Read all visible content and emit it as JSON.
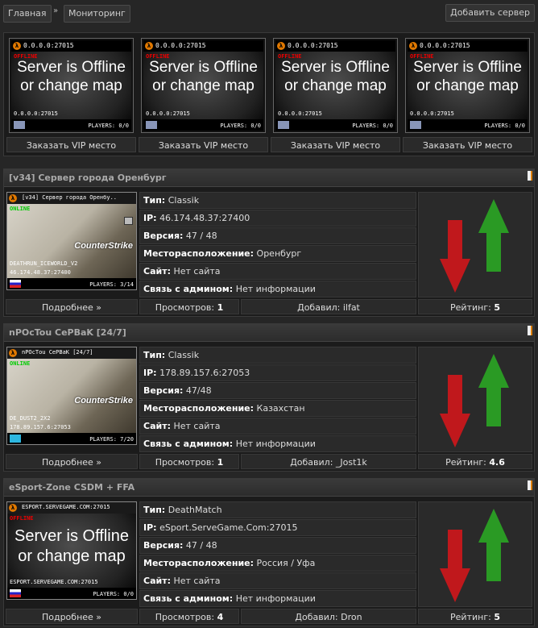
{
  "header": {
    "home": "Главная",
    "sep": "»",
    "monitoring": "Мониторинг",
    "add_server": "Добавить сервер"
  },
  "vip": {
    "ip": "0.0.0.0:27015",
    "status": "OFFLINE",
    "message_line1": "Server is Offline",
    "message_line2": "or change map",
    "players": "PLAYERS: 0/0",
    "order_label": "Заказать VIP место"
  },
  "labels": {
    "type": "Тип:",
    "ip": "IP:",
    "version": "Версия:",
    "location": "Месторасположение:",
    "site": "Сайт:",
    "contact": "Связь с админом:",
    "more": "Подробнее »",
    "views": "Просмотров:",
    "added": "Добавил:",
    "rating": "Рейтинг:"
  },
  "servers": [
    {
      "title": "[v34] Сервер города Оренбург",
      "banner_name": "[v34] Сервер города Оренбу..",
      "banner_status": "ONLINE",
      "banner_map": "DEATHRUN_ICEWORLD_V2",
      "banner_ip": "46.174.48.37:27400",
      "banner_players": "PLAYERS: 3/14",
      "type": "Classik",
      "ip": "46.174.48.37:27400",
      "version": "47 / 48",
      "location": "Оренбург",
      "site": "Нет сайта",
      "contact": "Нет информации",
      "views": "1",
      "added_by": "ilfat",
      "rating": "5"
    },
    {
      "title": "nPOcTou CePBaK [24/7]",
      "banner_name": "nPOcTou CePBaK [24/7]",
      "banner_status": "ONLINE",
      "banner_map": "DE_DUST2_2X2",
      "banner_ip": "178.89.157.6:27053",
      "banner_players": "PLAYERS: 7/20",
      "type": "Classik",
      "ip": "178.89.157.6:27053",
      "version": "47/48",
      "location": "Казахстан",
      "site": "Нет сайта",
      "contact": "Нет информации",
      "views": "1",
      "added_by": "_Jost1k",
      "rating": "4.6"
    },
    {
      "title": "eSport-Zone CSDM + FFA",
      "banner_name": "ESPORT.SERVEGAME.COM:27015",
      "banner_status": "OFFLINE",
      "banner_line1": "Server is Offline",
      "banner_line2": "or change map",
      "banner_ip": "ESPORT.SERVEGAME.COM:27015",
      "banner_players": "PLAYERS: 0/0",
      "type": "DeathMatch",
      "ip": "eSport.ServeGame.Com:27015",
      "version": "47 / 48",
      "location": "Россия / Уфа",
      "site": "Нет сайта",
      "contact": "Нет информации",
      "views": "4",
      "added_by": "Dron",
      "rating": "5"
    }
  ],
  "colors": {
    "vote_down": "#c0181c",
    "vote_up": "#2a9a24"
  }
}
